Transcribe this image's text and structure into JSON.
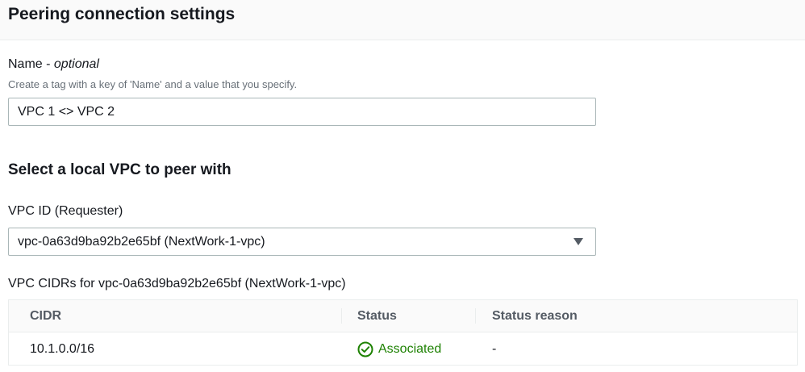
{
  "panel": {
    "title": "Peering connection settings"
  },
  "name_field": {
    "label": "Name - ",
    "optional": "optional",
    "description": "Create a tag with a key of 'Name' and a value that you specify.",
    "value": "VPC 1 <> VPC 2"
  },
  "local_vpc": {
    "section_title": "Select a local VPC to peer with",
    "label": "VPC ID (Requester)",
    "selected": "vpc-0a63d9ba92b2e65bf (NextWork-1-vpc)"
  },
  "cidr_table": {
    "caption": "VPC CIDRs for vpc-0a63d9ba92b2e65bf (NextWork-1-vpc)",
    "headers": [
      "CIDR",
      "Status",
      "Status reason"
    ],
    "rows": [
      {
        "cidr": "10.1.0.0/16",
        "status": "Associated",
        "reason": "-"
      }
    ]
  },
  "colors": {
    "success": "#1d8102",
    "text": "#16191f",
    "muted": "#687078"
  },
  "icons": {
    "status": "check-circle-icon",
    "select": "caret-down-icon"
  }
}
